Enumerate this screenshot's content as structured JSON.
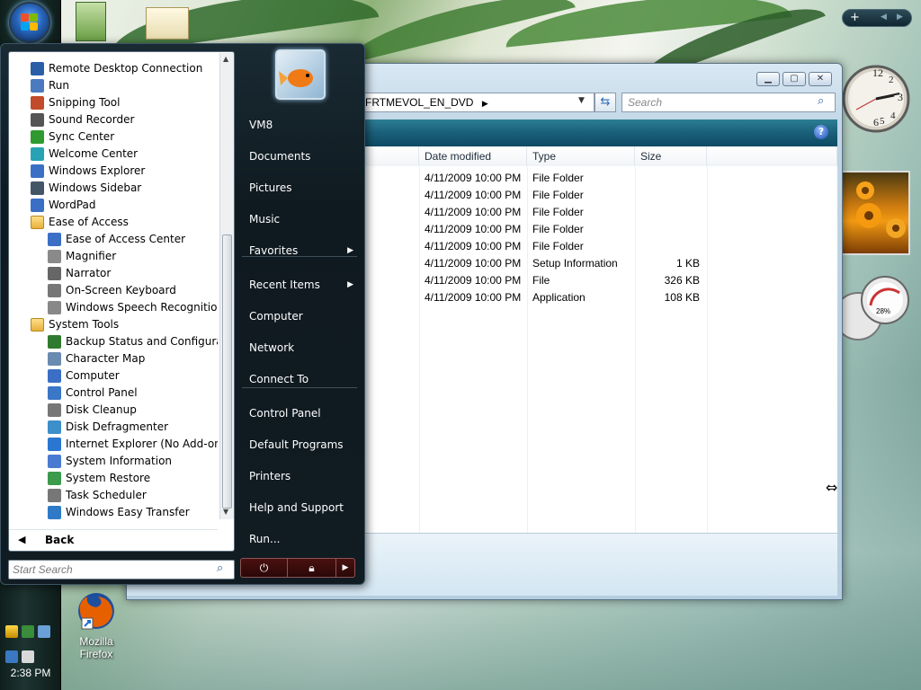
{
  "taskbar": {
    "clock": "2:38 PM"
  },
  "desktop_icons": [
    {
      "name": "Mozilla Firefox",
      "line1": "Mozilla",
      "line2": "Firefox"
    }
  ],
  "explorer": {
    "address_tail": "FRTMEVOL_EN_DVD",
    "search_placeholder": "Search",
    "columns": [
      "Date modified",
      "Type",
      "Size"
    ],
    "rows": [
      {
        "date": "4/11/2009 10:00 PM",
        "type": "File Folder",
        "size": ""
      },
      {
        "date": "4/11/2009 10:00 PM",
        "type": "File Folder",
        "size": ""
      },
      {
        "date": "4/11/2009 10:00 PM",
        "type": "File Folder",
        "size": ""
      },
      {
        "date": "4/11/2009 10:00 PM",
        "type": "File Folder",
        "size": ""
      },
      {
        "date": "4/11/2009 10:00 PM",
        "type": "File Folder",
        "size": ""
      },
      {
        "date": "4/11/2009 10:00 PM",
        "type": "Setup Information",
        "size": "1 KB"
      },
      {
        "date": "4/11/2009 10:00 PM",
        "type": "File",
        "size": "326 KB"
      },
      {
        "date": "4/11/2009 10:00 PM",
        "type": "Application",
        "size": "108 KB"
      }
    ],
    "help_label": "?"
  },
  "gadgets": {
    "meter_percent": "28%"
  },
  "start_menu": {
    "programs": [
      {
        "label": "Remote Desktop Connection",
        "indent": 0,
        "icon": "remote-desktop-icon"
      },
      {
        "label": "Run",
        "indent": 0,
        "icon": "run-icon"
      },
      {
        "label": "Snipping Tool",
        "indent": 0,
        "icon": "scissors-icon"
      },
      {
        "label": "Sound Recorder",
        "indent": 0,
        "icon": "microphone-icon"
      },
      {
        "label": "Sync Center",
        "indent": 0,
        "icon": "sync-icon"
      },
      {
        "label": "Welcome Center",
        "indent": 0,
        "icon": "welcome-icon"
      },
      {
        "label": "Windows Explorer",
        "indent": 0,
        "icon": "explorer-icon"
      },
      {
        "label": "Windows Sidebar",
        "indent": 0,
        "icon": "sidebar-icon"
      },
      {
        "label": "WordPad",
        "indent": 0,
        "icon": "wordpad-icon"
      },
      {
        "label": "Ease of Access",
        "indent": 0,
        "icon": "folder-icon"
      },
      {
        "label": "Ease of Access Center",
        "indent": 1,
        "icon": "ease-of-access-icon"
      },
      {
        "label": "Magnifier",
        "indent": 1,
        "icon": "magnifier-icon"
      },
      {
        "label": "Narrator",
        "indent": 1,
        "icon": "narrator-icon"
      },
      {
        "label": "On-Screen Keyboard",
        "indent": 1,
        "icon": "keyboard-icon"
      },
      {
        "label": "Windows Speech Recognition",
        "indent": 1,
        "icon": "speech-icon"
      },
      {
        "label": "System Tools",
        "indent": 0,
        "icon": "folder-icon"
      },
      {
        "label": "Backup Status and Configuration",
        "indent": 1,
        "icon": "backup-icon"
      },
      {
        "label": "Character Map",
        "indent": 1,
        "icon": "charmap-icon"
      },
      {
        "label": "Computer",
        "indent": 1,
        "icon": "computer-icon"
      },
      {
        "label": "Control Panel",
        "indent": 1,
        "icon": "control-panel-icon"
      },
      {
        "label": "Disk Cleanup",
        "indent": 1,
        "icon": "disk-cleanup-icon"
      },
      {
        "label": "Disk Defragmenter",
        "indent": 1,
        "icon": "defrag-icon"
      },
      {
        "label": "Internet Explorer (No Add-ons)",
        "indent": 1,
        "icon": "ie-icon"
      },
      {
        "label": "System Information",
        "indent": 1,
        "icon": "info-icon"
      },
      {
        "label": "System Restore",
        "indent": 1,
        "icon": "restore-icon"
      },
      {
        "label": "Task Scheduler",
        "indent": 1,
        "icon": "clock-icon"
      },
      {
        "label": "Windows Easy Transfer",
        "indent": 1,
        "icon": "transfer-icon"
      }
    ],
    "back_label": "Back",
    "search_placeholder": "Start Search",
    "right_items": [
      {
        "label": "VM8",
        "arrow": false
      },
      {
        "label": "Documents",
        "arrow": false
      },
      {
        "label": "Pictures",
        "arrow": false
      },
      {
        "label": "Music",
        "arrow": false
      },
      {
        "label": "Favorites",
        "arrow": true
      },
      {
        "label": "Recent Items",
        "arrow": true
      },
      {
        "label": "Computer",
        "arrow": false
      },
      {
        "label": "Network",
        "arrow": false
      },
      {
        "label": "Connect To",
        "arrow": false
      },
      {
        "label": "Control Panel",
        "arrow": false
      },
      {
        "label": "Default Programs",
        "arrow": false
      },
      {
        "label": "Printers",
        "arrow": false
      },
      {
        "label": "Help and Support",
        "arrow": false
      },
      {
        "label": "Run...",
        "arrow": false
      }
    ]
  },
  "colors": {
    "start_menu_bg": "#111b22",
    "accent_orb": "#2663b8",
    "cmdbar": "#1a5f79"
  }
}
